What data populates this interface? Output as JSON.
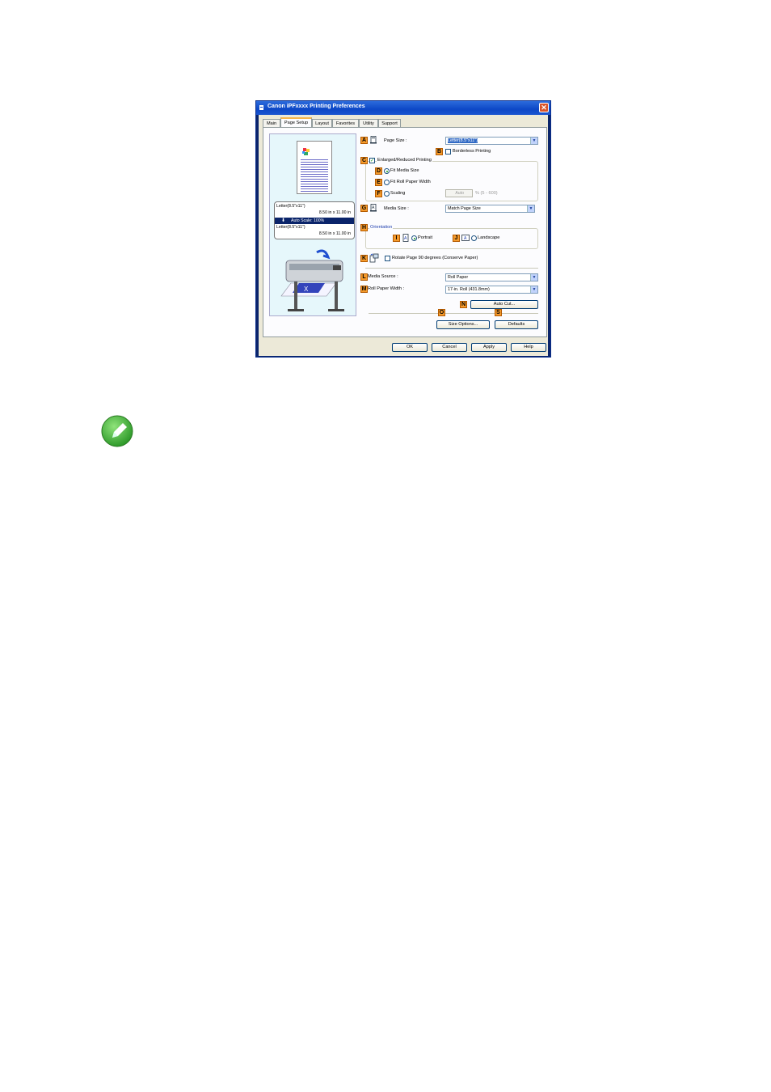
{
  "window": {
    "title": "Canon iPFxxxx Printing Preferences",
    "close_glyph": "✕"
  },
  "tabs": [
    {
      "label": "Main"
    },
    {
      "label": "Page Setup"
    },
    {
      "label": "Layout"
    },
    {
      "label": "Favorites"
    },
    {
      "label": "Utility"
    },
    {
      "label": "Support"
    }
  ],
  "preview": {
    "line1": "Letter(8.5\"x11\")",
    "line2": "8.50 in x 11.00 in",
    "scale": "Auto Scale: 100%",
    "line3": "Letter(8.5\"x11\")",
    "line4": "8.50 in x 11.00 in"
  },
  "keys": {
    "A": "A",
    "B": "B",
    "C": "C",
    "D": "D",
    "E": "E",
    "F": "F",
    "G": "G",
    "H": "H",
    "I": "I",
    "J": "J",
    "K": "K",
    "L": "L",
    "M": "M",
    "N": "N",
    "O": "O",
    "S": "S"
  },
  "page_size": {
    "label": "Page Size :",
    "value": "Letter(8.5\"x11\")"
  },
  "borderless": {
    "label": "Borderless Printing",
    "checked": false
  },
  "enlarged": {
    "label": "Enlarged/Reduced Printing",
    "checked": true,
    "check_glyph": "✓"
  },
  "fit_media": {
    "label": "Fit Media Size",
    "selected": true
  },
  "fit_roll": {
    "label": "Fit Roll Paper Width",
    "selected": false
  },
  "scaling": {
    "label": "Scaling",
    "value": "Auto",
    "range": "% (5 - 600)",
    "selected": false
  },
  "media_size": {
    "label": "Media Size :",
    "value": "Match Page Size"
  },
  "orientation": {
    "label": "Orientation",
    "portrait": "Portrait",
    "landscape": "Landscape",
    "portrait_selected": true
  },
  "rotate": {
    "label": "Rotate Page 90 degrees (Conserve Paper)",
    "checked": false
  },
  "media_source": {
    "label": "Media Source :",
    "value": "Roll Paper"
  },
  "roll_width": {
    "label": "Roll Paper Width :",
    "value": "17-in. Roll (431.8mm)"
  },
  "buttons": {
    "auto_cut": "Auto Cut...",
    "size_options": "Size Options...",
    "defaults": "Defaults",
    "ok": "OK",
    "cancel": "Cancel",
    "apply": "Apply",
    "help": "Help"
  },
  "colors": {
    "titlebar": "#0d48c6",
    "key_orange": "#f59a2b",
    "note_green": "#3cb043"
  },
  "icons": {
    "note": "pencil-note-icon",
    "arrow": "chevron-down-icon"
  }
}
